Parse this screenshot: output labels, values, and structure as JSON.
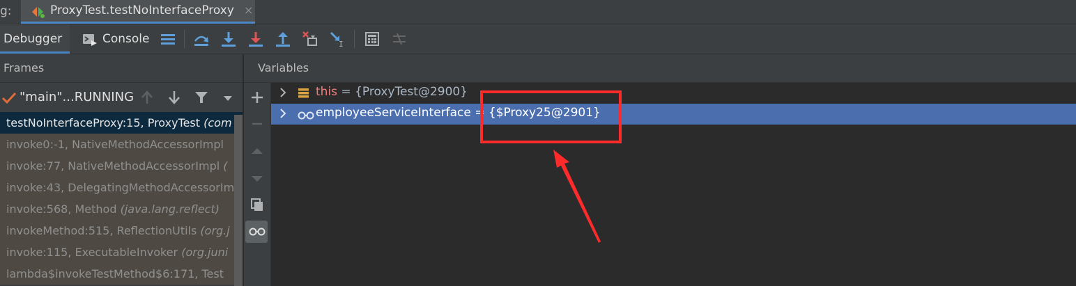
{
  "window": {
    "debug_prefix": "g:",
    "session_tab": {
      "label": "ProxyTest.testNoInterfaceProxy",
      "close": "×"
    }
  },
  "toolbar": {
    "debugger_tab": "Debugger",
    "console_tab": "Console",
    "buttons": [
      "layout-icon",
      "show-execution-point-icon",
      "step-over-icon",
      "step-into-icon",
      "force-step-into-icon",
      "step-out-icon",
      "drop-frame-icon",
      "run-to-cursor-icon",
      "evaluate-expression-icon",
      "trace-icon"
    ]
  },
  "frames": {
    "header": "Frames",
    "thread": "\"main\"...RUNNING",
    "items": [
      {
        "method": "testNoInterfaceProxy:15, ProxyTest ",
        "pkg": "(com"
      },
      {
        "method": "invoke0:-1, NativeMethodAccessorImpl ",
        "pkg": ""
      },
      {
        "method": "invoke:77, NativeMethodAccessorImpl ",
        "pkg": "("
      },
      {
        "method": "invoke:43, DelegatingMethodAccessorIm",
        "pkg": ""
      },
      {
        "method": "invoke:568, Method ",
        "pkg": "(java.lang.reflect)"
      },
      {
        "method": "invokeMethod:515, ReflectionUtils ",
        "pkg": "(org.j"
      },
      {
        "method": "invoke:115, ExecutableInvoker ",
        "pkg": "(org.juni"
      },
      {
        "method": "lambda$invokeTestMethod$6:171, Test",
        "pkg": ""
      }
    ]
  },
  "variables": {
    "header": "Variables",
    "rows": [
      {
        "name": "this",
        "eq": " = ",
        "value": "{ProxyTest@2900}"
      },
      {
        "name": "employeeServiceInterface",
        "eq": " = ",
        "value": "{$Proxy25@2901}"
      }
    ]
  },
  "colors": {
    "selected_row": "#4b6eaf",
    "annotation": "#ff2a2a",
    "accent": "#4a88c7"
  }
}
